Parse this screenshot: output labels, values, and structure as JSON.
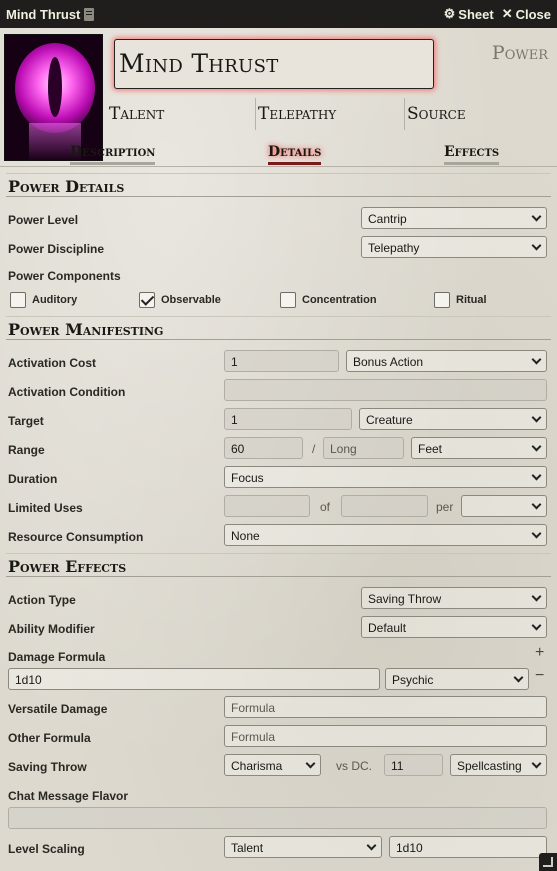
{
  "window": {
    "title": "Mind Thrust",
    "sheet_label": "Sheet",
    "close_label": "Close"
  },
  "header": {
    "name": "Mind Thrust",
    "item_type": "Power",
    "summary": [
      "Talent",
      "Telepathy",
      "Source"
    ]
  },
  "tabs": [
    {
      "label": "Description",
      "active": false
    },
    {
      "label": "Details",
      "active": true
    },
    {
      "label": "Effects",
      "active": false
    }
  ],
  "power_details": {
    "heading": "Power Details",
    "level_label": "Power Level",
    "level_value": "Cantrip",
    "discipline_label": "Power Discipline",
    "discipline_value": "Telepathy",
    "components_label": "Power Components",
    "components": [
      {
        "label": "Auditory",
        "checked": false
      },
      {
        "label": "Observable",
        "checked": true
      },
      {
        "label": "Concentration",
        "checked": false
      },
      {
        "label": "Ritual",
        "checked": false
      }
    ]
  },
  "manifesting": {
    "heading": "Power Manifesting",
    "activation_cost_label": "Activation Cost",
    "activation_cost_value": "1",
    "activation_type": "Bonus Action",
    "activation_condition_label": "Activation Condition",
    "activation_condition_value": "",
    "target_label": "Target",
    "target_value": "1",
    "target_type": "Creature",
    "range_label": "Range",
    "range_value": "60",
    "range_sep": "/",
    "range_long_placeholder": "Long",
    "range_units": "Feet",
    "duration_label": "Duration",
    "duration_value": "Focus",
    "limited_uses_label": "Limited Uses",
    "of_label": "of",
    "per_label": "per",
    "resource_label": "Resource Consumption",
    "resource_value": "None"
  },
  "effects": {
    "heading": "Power Effects",
    "action_type_label": "Action Type",
    "action_type_value": "Saving Throw",
    "ability_label": "Ability Modifier",
    "ability_value": "Default",
    "damage_label": "Damage Formula",
    "damage_formula": "1d10",
    "damage_type": "Psychic",
    "versatile_label": "Versatile Damage",
    "versatile_placeholder": "Formula",
    "other_label": "Other Formula",
    "other_placeholder": "Formula",
    "save_label": "Saving Throw",
    "save_ability": "Charisma",
    "vs_dc_label": "vs DC.",
    "dc_value": "11",
    "dc_scaling": "Spellcasting",
    "flavor_label": "Chat Message Flavor",
    "flavor_value": "",
    "scaling_label": "Level Scaling",
    "scaling_mode": "Talent",
    "scaling_formula": "1d10"
  }
}
